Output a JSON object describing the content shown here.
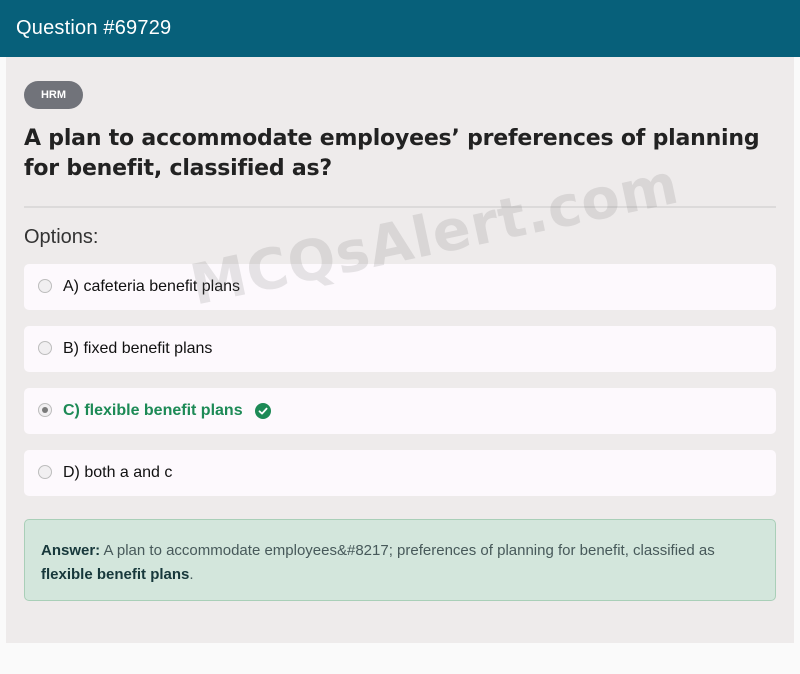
{
  "header": {
    "title": "Question #69729"
  },
  "tag": {
    "label": "HRM"
  },
  "question": {
    "text": "A plan to accommodate employees’ preferences of planning for benefit, classified as?"
  },
  "options_label": "Options:",
  "options": [
    {
      "label": "A) cafeteria benefit plans",
      "selected": false,
      "correct": false
    },
    {
      "label": "B) fixed benefit plans",
      "selected": false,
      "correct": false
    },
    {
      "label": "C) flexible benefit plans",
      "selected": true,
      "correct": true
    },
    {
      "label": "D) both a and c",
      "selected": false,
      "correct": false
    }
  ],
  "answer": {
    "prefix": "Answer:",
    "text": " A plan to accommodate employees&#8217; preferences of planning for benefit, classified as ",
    "highlight": "flexible benefit plans",
    "suffix": "."
  },
  "watermark": "MCQsAlert.com",
  "colors": {
    "header_bg": "#07607a",
    "correct_green": "#1d8a56",
    "answer_bg": "#d3e6dc",
    "tag_bg": "#71737a"
  },
  "icons": {
    "correct_option": "check-circle-icon"
  }
}
